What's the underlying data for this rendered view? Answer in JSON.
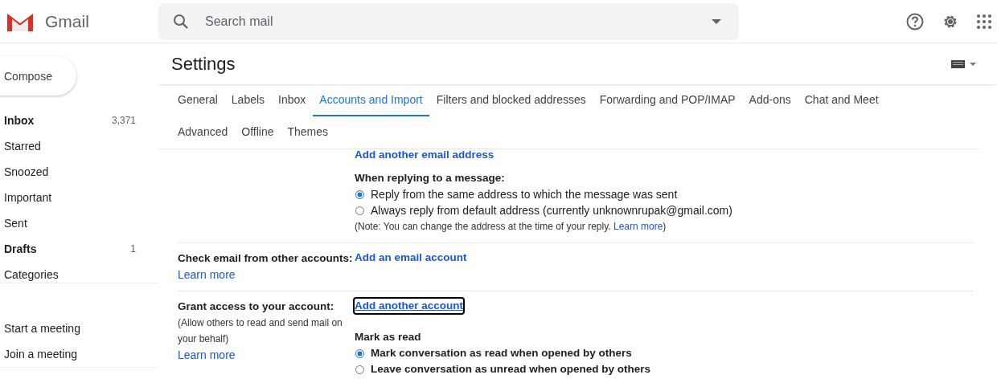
{
  "header": {
    "app_name": "Gmail",
    "search": {
      "placeholder": "Search mail"
    }
  },
  "sidebar": {
    "compose": "Compose",
    "items": [
      {
        "label": "Inbox",
        "count": "3,371",
        "bold": true
      },
      {
        "label": "Starred",
        "bold": false
      },
      {
        "label": "Snoozed",
        "bold": false
      },
      {
        "label": "Important",
        "bold": false
      },
      {
        "label": "Sent",
        "bold": false
      },
      {
        "label": "Drafts",
        "count": "1",
        "bold": true
      },
      {
        "label": "Categories",
        "bold": false
      }
    ],
    "meet": [
      "Start a meeting",
      "Join a meeting"
    ]
  },
  "settings": {
    "title": "Settings",
    "tabs": [
      {
        "label": "General",
        "selected": false
      },
      {
        "label": "Labels",
        "selected": false
      },
      {
        "label": "Inbox",
        "selected": false
      },
      {
        "label": "Accounts and Import",
        "selected": true
      },
      {
        "label": "Filters and blocked addresses",
        "selected": false
      },
      {
        "label": "Forwarding and POP/IMAP",
        "selected": false
      },
      {
        "label": "Add-ons",
        "selected": false
      },
      {
        "label": "Chat and Meet",
        "selected": false
      },
      {
        "label": "Advanced",
        "selected": false
      },
      {
        "label": "Offline",
        "selected": false
      },
      {
        "label": "Themes",
        "selected": false
      }
    ],
    "sections": [
      {
        "link": "Add another email address",
        "focused": false,
        "group": {
          "heading": "When replying to a message:",
          "bold_options": false,
          "options": [
            {
              "label": "Reply from the same address to which the message was sent",
              "selected": true
            },
            {
              "label": "Always reply from default address (currently unknownrupak@gmail.com)",
              "selected": false
            }
          ],
          "note": "(Note: You can change the address at the time of your reply. ",
          "note_link": "Learn more",
          "note_end": ")"
        }
      },
      {
        "label": "Check email from other accounts:",
        "learn_more": "Learn more",
        "link": "Add an email account",
        "focused": false
      },
      {
        "label": "Grant access to your account:",
        "note": "(Allow others to read and send mail on your behalf)",
        "learn_more": "Learn more",
        "link": "Add another account",
        "focused": true,
        "group": {
          "heading": "Mark as read",
          "bold_options": true,
          "options": [
            {
              "label": "Mark conversation as read when opened by others",
              "selected": true
            },
            {
              "label": "Leave conversation as unread when opened by others",
              "selected": false
            }
          ]
        }
      }
    ]
  }
}
